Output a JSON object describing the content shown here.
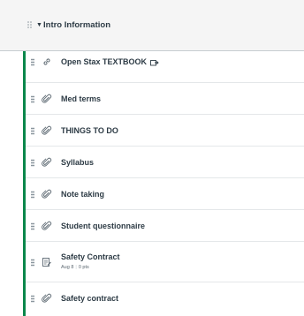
{
  "module": {
    "title": "Intro Information"
  },
  "items": [
    {
      "label": "Open Stax TEXTBOOK",
      "icon": "link-icon",
      "external": true
    },
    {
      "label": "Med terms",
      "icon": "attachment-icon"
    },
    {
      "label": "THINGS TO DO",
      "icon": "attachment-icon"
    },
    {
      "label": "Syllabus",
      "icon": "attachment-icon"
    },
    {
      "label": "Note taking",
      "icon": "attachment-icon"
    },
    {
      "label": "Student questionnaire",
      "icon": "attachment-icon"
    },
    {
      "label": "Safety Contract",
      "icon": "assignment-icon",
      "due": "Aug 8",
      "points": "0 pts"
    },
    {
      "label": "Safety contract",
      "icon": "attachment-icon"
    }
  ],
  "colors": {
    "published_bar": "#0b874b",
    "text": "#2d3b45",
    "header_bg": "#f5f5f5"
  }
}
